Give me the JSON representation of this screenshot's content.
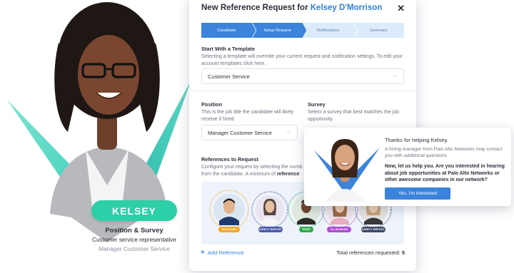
{
  "candidate": {
    "name_badge": "KELSEY",
    "role_heading": "Position & Survey",
    "role_line": "Customer service representative",
    "position_line": "Manager Customer Service"
  },
  "modal": {
    "title_prefix": "New Reference Request for ",
    "title_name": "Kelsey D'Morrison",
    "close_glyph": "✕",
    "steps": [
      {
        "label": "Candidate",
        "active": true
      },
      {
        "label": "Setup Request",
        "active": true
      },
      {
        "label": "Notifications",
        "active": false
      },
      {
        "label": "Summary",
        "active": false
      }
    ],
    "template": {
      "label": "Start With a Template",
      "desc": "Selecting a template will override your current request and notification settings. To edit your account templates click here.",
      "value": "Customer Service"
    },
    "position": {
      "label": "Position",
      "desc": "This is the job title the candidate will likely receive if hired.",
      "value": "Manager Customer Service"
    },
    "survey": {
      "label": "Survey",
      "desc": "Select a survey that best matches the job opportunity."
    },
    "references": {
      "label": "References to Request",
      "desc_a": "Configure your request by selecting the numb",
      "desc_b": "from the candidate. A minimum of ",
      "desc_b_bold": "reference"
    },
    "ref_badges": [
      {
        "label": "MANAGER",
        "color": "#f5a623"
      },
      {
        "label": "DIRECT REPORT",
        "color": "#4a5aa8"
      },
      {
        "label": "PEER",
        "color": "#2eaa4e"
      },
      {
        "label": "CO-WORKER",
        "color": "#b04ad6"
      },
      {
        "label": "DIRECT REPORT",
        "color": "#3d4a66"
      }
    ],
    "add_reference": "Add Reference",
    "total_label": "Total references requested: ",
    "total_value": "5"
  },
  "popup": {
    "title": "Thanks for helping Kelsey.",
    "message": "A hiring manager from Palo Alto Networks may contact you with additional questions",
    "question": "Now, let us help you. Are you interested in hearing about job opportunities at Palo Alto Networks or other awesome companies in our network?",
    "button": "Yes, I'm Interested"
  },
  "colors": {
    "accent": "#3b83db",
    "teal": "#2ccfa8",
    "step_inactive": "#dcebfb"
  }
}
